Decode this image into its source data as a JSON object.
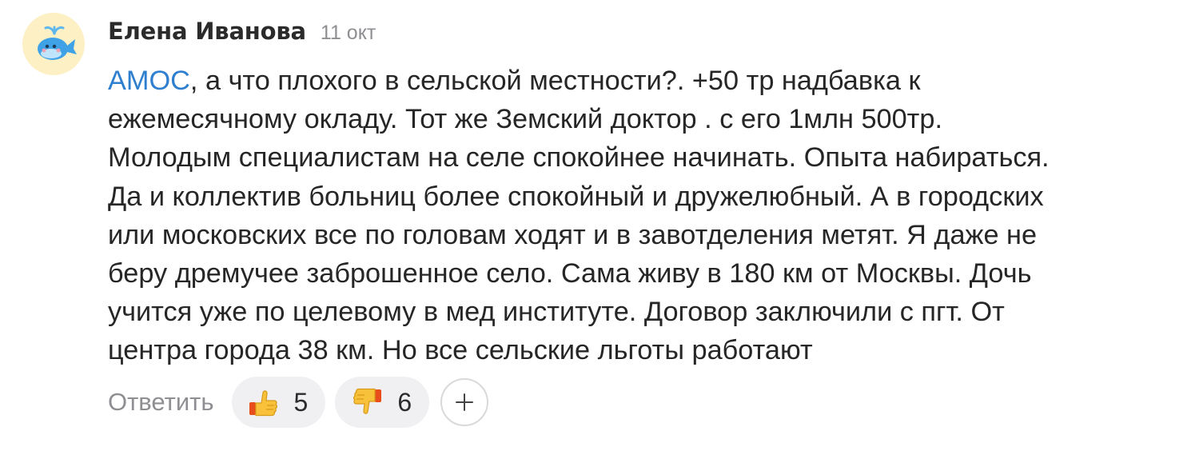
{
  "comment": {
    "author": "Елена Иванова",
    "date": "11 окт",
    "mention": "АМОС",
    "lines": [
      ", а что плохого в сельской местности?. +50 тр надбавка к",
      "ежемесячному окладу. Тот же Земский доктор . с его 1млн 500тр.",
      "Молодым специалистам на селе спокойнее начинать. Опыта набираться.",
      "Да и коллектив больниц более спокойный и дружелюбный. А в городских",
      "или московских все по головам ходят и в завотделения метят. Я даже не",
      "беру дремучее заброшенное село. Сама живу в 180 км от Москвы. Дочь",
      "учится уже по целевому в мед институте. Договор заключили с пгт. От",
      "центра города 38 км. Но все сельские льготы работают"
    ]
  },
  "actions": {
    "reply_label": "Ответить",
    "likes": "5",
    "dislikes": "6",
    "add_reaction_icon": "plus-icon"
  },
  "icons": {
    "avatar": "whale-avatar",
    "like": "thumbs-up-icon",
    "dislike": "thumbs-down-icon"
  },
  "colors": {
    "mention": "#2f7fd0",
    "meta_gray": "#8e8e93",
    "reaction_bg": "#f0f0f2",
    "avatar_bg": "#fdf0c4"
  }
}
